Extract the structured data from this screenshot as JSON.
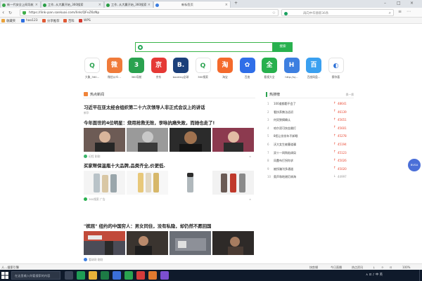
{
  "browser": {
    "tabs": [
      {
        "label": "新一代安全上网导航",
        "favicon_color": "#3aa64b"
      },
      {
        "label": "工作, 从大赢开始_360搜索",
        "favicon_color": "#2a9d45"
      },
      {
        "label": "工作, 从大赢开始_360搜索",
        "favicon_color": "#2a9d45"
      },
      {
        "label": "新标签页",
        "favicon_color": "#3b7de0"
      }
    ],
    "url": "https://link-pan.sankuai.com/link/QFvZ6zNp",
    "search_placeholder": "再向中华赫新36条",
    "bookmarks": [
      {
        "label": "收藏夹",
        "color": "#e9a23b"
      },
      {
        "label": "hao123",
        "color": "#2d6ee0"
      },
      {
        "label": "分享推荐",
        "color": "#e05a36"
      },
      {
        "label": "百科",
        "color": "#e05a36"
      },
      {
        "label": "WPS",
        "color": "#d43a2f"
      }
    ]
  },
  "search": {
    "placeholder": "",
    "button_label": "搜索"
  },
  "apps": [
    {
      "label": "大象_360...",
      "glyph": "Q",
      "color": "#ffffff",
      "text_color": "#2aa24f"
    },
    {
      "label": "微信公众...",
      "glyph": "微",
      "color": "#f07b3a",
      "text_color": "#ffffff"
    },
    {
      "label": "360导航",
      "glyph": "3",
      "color": "#2aa24f",
      "text_color": "#ffffff"
    },
    {
      "label": "京东",
      "glyph": "京",
      "color": "#e53935",
      "text_color": "#ffffff"
    },
    {
      "label": "booking全球",
      "glyph": "B.",
      "color": "#1b3f7a",
      "text_color": "#ffffff"
    },
    {
      "label": "360搜索",
      "glyph": "Q",
      "color": "#ffffff",
      "text_color": "#2aa24f"
    },
    {
      "label": "淘宝",
      "glyph": "淘",
      "color": "#f46a2c",
      "text_color": "#ffffff"
    },
    {
      "label": "百度",
      "glyph": "✿",
      "color": "#2f6ee8",
      "text_color": "#ffffff"
    },
    {
      "label": "看视大全",
      "glyph": "全",
      "color": "#27b04d",
      "text_color": "#ffffff"
    },
    {
      "label": "http://sj...",
      "glyph": "H",
      "color": "#3d7fe0",
      "text_color": "#ffffff"
    },
    {
      "label": "百度网盘...",
      "glyph": "百",
      "color": "#3aa0f0",
      "text_color": "#ffffff"
    },
    {
      "label": "猜你喜",
      "glyph": "◐",
      "color": "#ffffff",
      "text_color": "#2b6fd6"
    }
  ],
  "news": {
    "section_title": "热点新闻",
    "items": [
      {
        "title": "习近平在亚太经合组织第二十六次领导人非正式会议上的讲话",
        "source": "新华"
      },
      {
        "title": "今年面世的4位明星：烧用抢救无效，李咏抗癌失败，而她也走了!",
        "source": "纪程  刚刚"
      },
      {
        "title": "买家帮保温瓶十大品牌,品类齐全,价更低.",
        "source": "360搜索  广告"
      },
      {
        "title": "\"槟屈\" 纽约的中国穷人：男女同住，没有私隐，却仍然不愿回国",
        "source": "看球网 刚刚"
      }
    ]
  },
  "hot": {
    "title": "热搜榜",
    "more": "换一换",
    "items": [
      {
        "rank": "1",
        "title": "100道都题不会了",
        "count": "48641",
        "trend": "up"
      },
      {
        "rank": "2",
        "title": "看扶养携法适初",
        "count": "46139",
        "trend": "up"
      },
      {
        "rank": "3",
        "title": "何炅狼摘确认",
        "count": "45651",
        "trend": "up"
      },
      {
        "rank": "4",
        "title": "哈尔滨可快金嫩打",
        "count": "45601",
        "trend": "up"
      },
      {
        "rank": "5",
        "title": "8招让份份年不卸眼",
        "count": "45278",
        "trend": "up"
      },
      {
        "rank": "6",
        "title": "沃大女生被曹道骥",
        "count": "45194",
        "trend": "up"
      },
      {
        "rank": "7",
        "title": "双十一网购陷调局",
        "count": "45123",
        "trend": "up"
      },
      {
        "rank": "8",
        "title": "凤蠢布打拐你求",
        "count": "45026",
        "trend": "up"
      },
      {
        "rank": "9",
        "title": "被拐骗刊多通道",
        "count": "45020",
        "trend": "up"
      },
      {
        "rank": "10",
        "title": "奥声和地谢尼病海",
        "count": "44997",
        "trend": "down"
      }
    ]
  },
  "float_button": "BUSA",
  "status": {
    "left": "人…搜索引擎",
    "right_items": [
      "快剪辑",
      "今日直播",
      "热点资讯",
      "↓",
      "☼",
      "⊡",
      "100%"
    ]
  },
  "taskbar": {
    "search_placeholder": "在这里输入你要搜索的内容",
    "apps": [
      {
        "name": "task-view",
        "color": "#3a4558"
      },
      {
        "name": "app-green",
        "color": "#1f9d55"
      },
      {
        "name": "file-explorer",
        "color": "#e8b23a"
      },
      {
        "name": "excel",
        "color": "#1d7a45"
      },
      {
        "name": "app-blue",
        "color": "#3b6fd9"
      },
      {
        "name": "browser-360",
        "color": "#2aa24f"
      },
      {
        "name": "app-red",
        "color": "#d53b3b"
      },
      {
        "name": "app-orange",
        "color": "#e07a2f"
      },
      {
        "name": "app-purple",
        "color": "#7b4fd0"
      }
    ],
    "tray_text": "∧ ⊡ ♪ 中 英",
    "time": "",
    "date": ""
  }
}
